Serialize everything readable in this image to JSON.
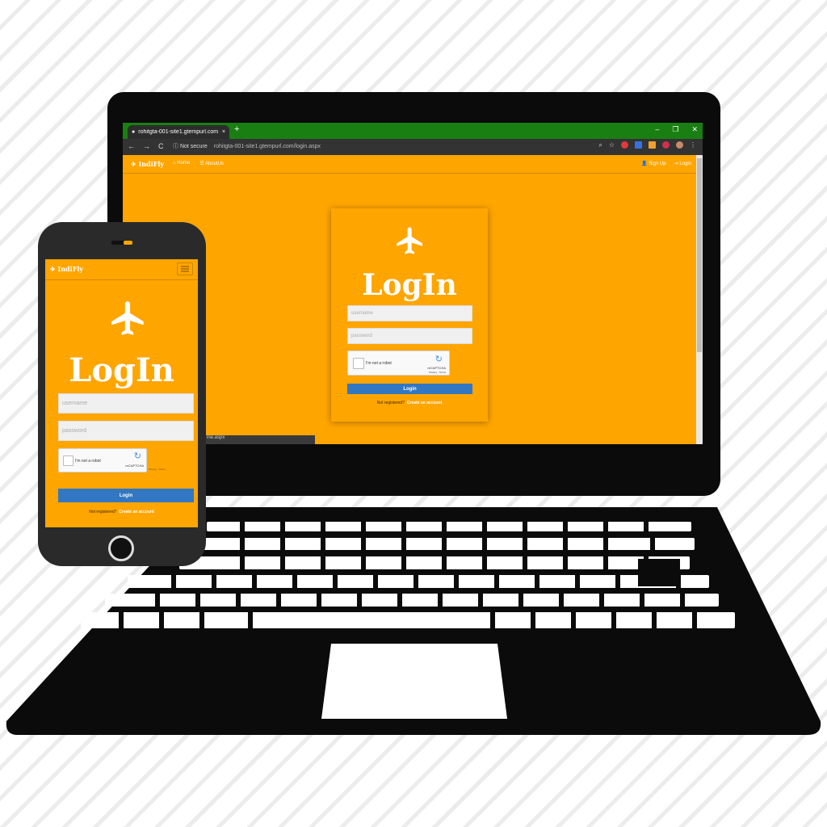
{
  "browser": {
    "tab_title": "rohitgta-001-site1.gtempurl.com",
    "tab_close": "×",
    "new_tab": "+",
    "win_min": "–",
    "win_max": "❐",
    "win_close": "✕",
    "nav_back": "←",
    "nav_forward": "→",
    "nav_reload": "C",
    "security": "Not secure",
    "url": "rohitgta-001-site1.gtempurl.com/login.aspx",
    "status_url": "ine.aspx"
  },
  "site": {
    "brand": "IndiFly",
    "nav_home": "Home",
    "nav_aboutus": "AboutUs",
    "nav_signup": "Sign Up",
    "nav_login": "Login"
  },
  "login": {
    "title": "LogIn",
    "username_placeholder": "username",
    "password_placeholder": "password",
    "captcha_label": "I'm not a robot",
    "captcha_brand": "reCAPTCHA",
    "captcha_terms": "Privacy - Terms",
    "button_label": "Login",
    "register_prompt": "Not registered?",
    "register_link": "Create an account"
  },
  "colors": {
    "accent": "#ffa500",
    "button": "#3277c2",
    "browser_tabbar": "#1a7f12",
    "device": "#0b0b0b"
  },
  "icons": [
    "airplane-icon",
    "globe-icon",
    "home-icon",
    "menu-icon",
    "user-icon",
    "login-icon",
    "recaptcha-icon",
    "hamburger-icon"
  ]
}
